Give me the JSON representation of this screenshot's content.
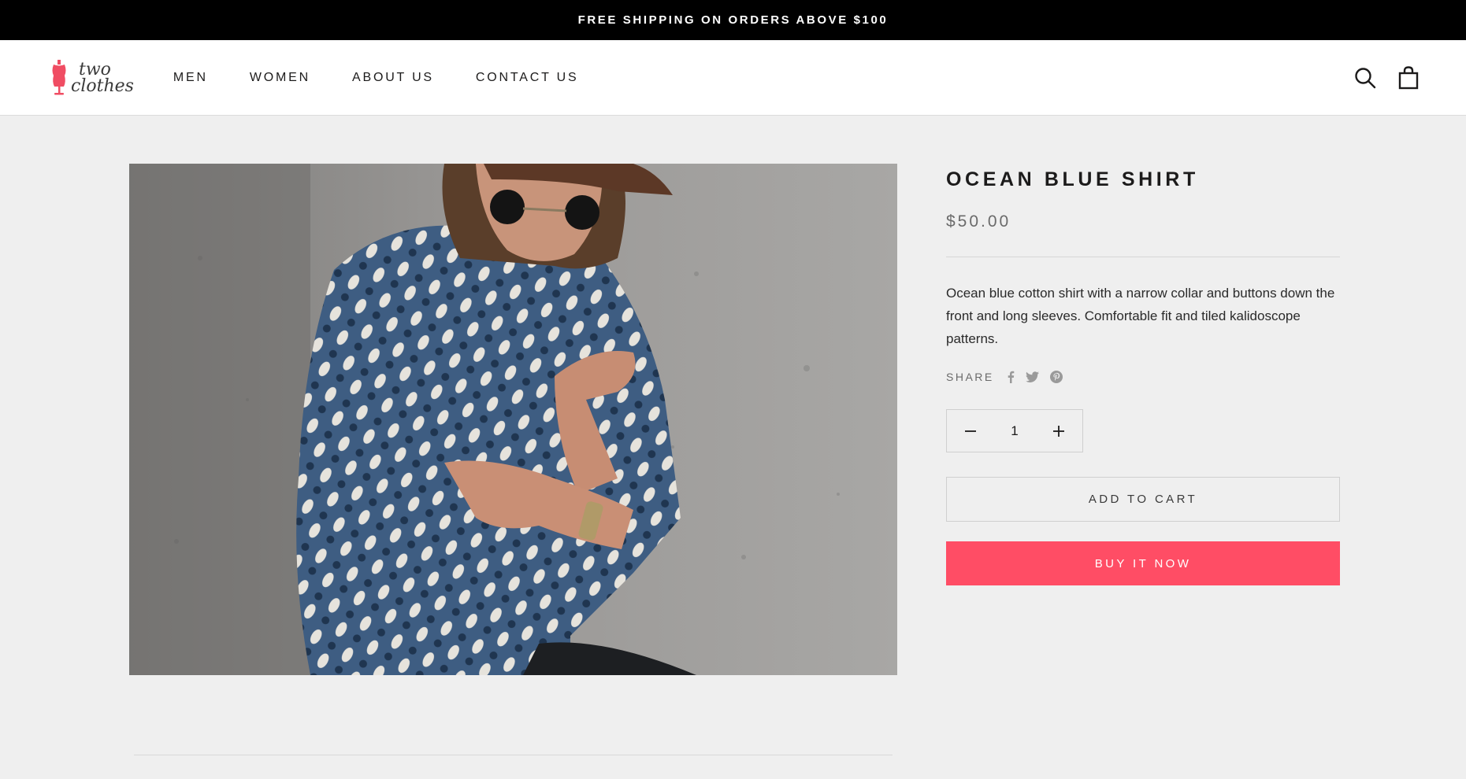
{
  "announcement": {
    "text": "FREE SHIPPING ON ORDERS ABOVE $100"
  },
  "header": {
    "logo": {
      "line1": "two",
      "line2": "clothes"
    },
    "nav": [
      {
        "label": "MEN"
      },
      {
        "label": "WOMEN"
      },
      {
        "label": "ABOUT US"
      },
      {
        "label": "CONTACT US"
      }
    ],
    "icons": [
      "search-icon",
      "shopping-bag-icon"
    ]
  },
  "product": {
    "title": "OCEAN BLUE SHIRT",
    "price": "$50.00",
    "description": "Ocean blue cotton shirt with a narrow collar and buttons down the front and long sleeves. Comfortable fit and tiled kalidoscope patterns.",
    "share_label": "SHARE",
    "share_icons": [
      "facebook-icon",
      "twitter-icon",
      "pinterest-icon"
    ],
    "quantity": "1",
    "add_to_cart_label": "ADD TO CART",
    "buy_now_label": "BUY IT NOW"
  },
  "colors": {
    "accent": "#ff4d65",
    "announcement_bg": "#000000",
    "page_bg": "#efefef",
    "logo_red": "#f04d63"
  }
}
